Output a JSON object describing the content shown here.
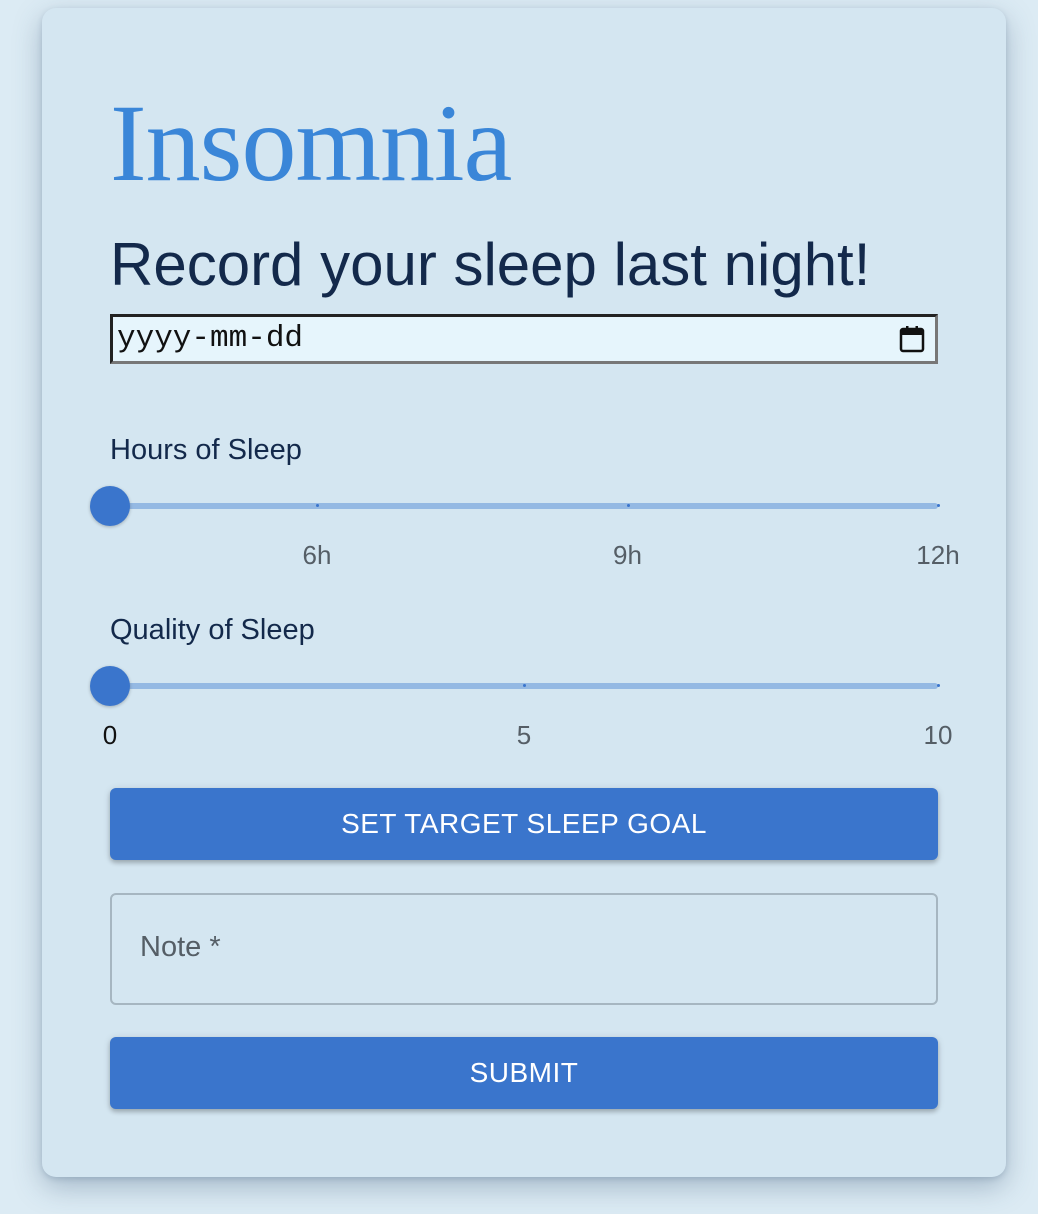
{
  "app": {
    "title": "Insomnia",
    "subtitle": "Record your sleep last night!"
  },
  "date_input": {
    "placeholder": "yyyy-mm-dd",
    "icon": "calendar-icon"
  },
  "hours_slider": {
    "label": "Hours of Sleep",
    "min": 4,
    "max": 12,
    "value": 4,
    "marks": [
      {
        "value": 6,
        "label": "6h"
      },
      {
        "value": 9,
        "label": "9h"
      },
      {
        "value": 12,
        "label": "12h"
      }
    ]
  },
  "quality_slider": {
    "label": "Quality of Sleep",
    "min": 0,
    "max": 10,
    "value": 0,
    "marks": [
      {
        "value": 0,
        "label": "0"
      },
      {
        "value": 5,
        "label": "5"
      },
      {
        "value": 10,
        "label": "10"
      }
    ]
  },
  "buttons": {
    "set_goal": "SET TARGET SLEEP GOAL",
    "submit": "SUBMIT"
  },
  "note": {
    "label": "Note *"
  },
  "colors": {
    "accent": "#3a75cc",
    "title": "#3a86d8",
    "card_background": "#d4e6f1",
    "rail": "#94b9e3"
  }
}
